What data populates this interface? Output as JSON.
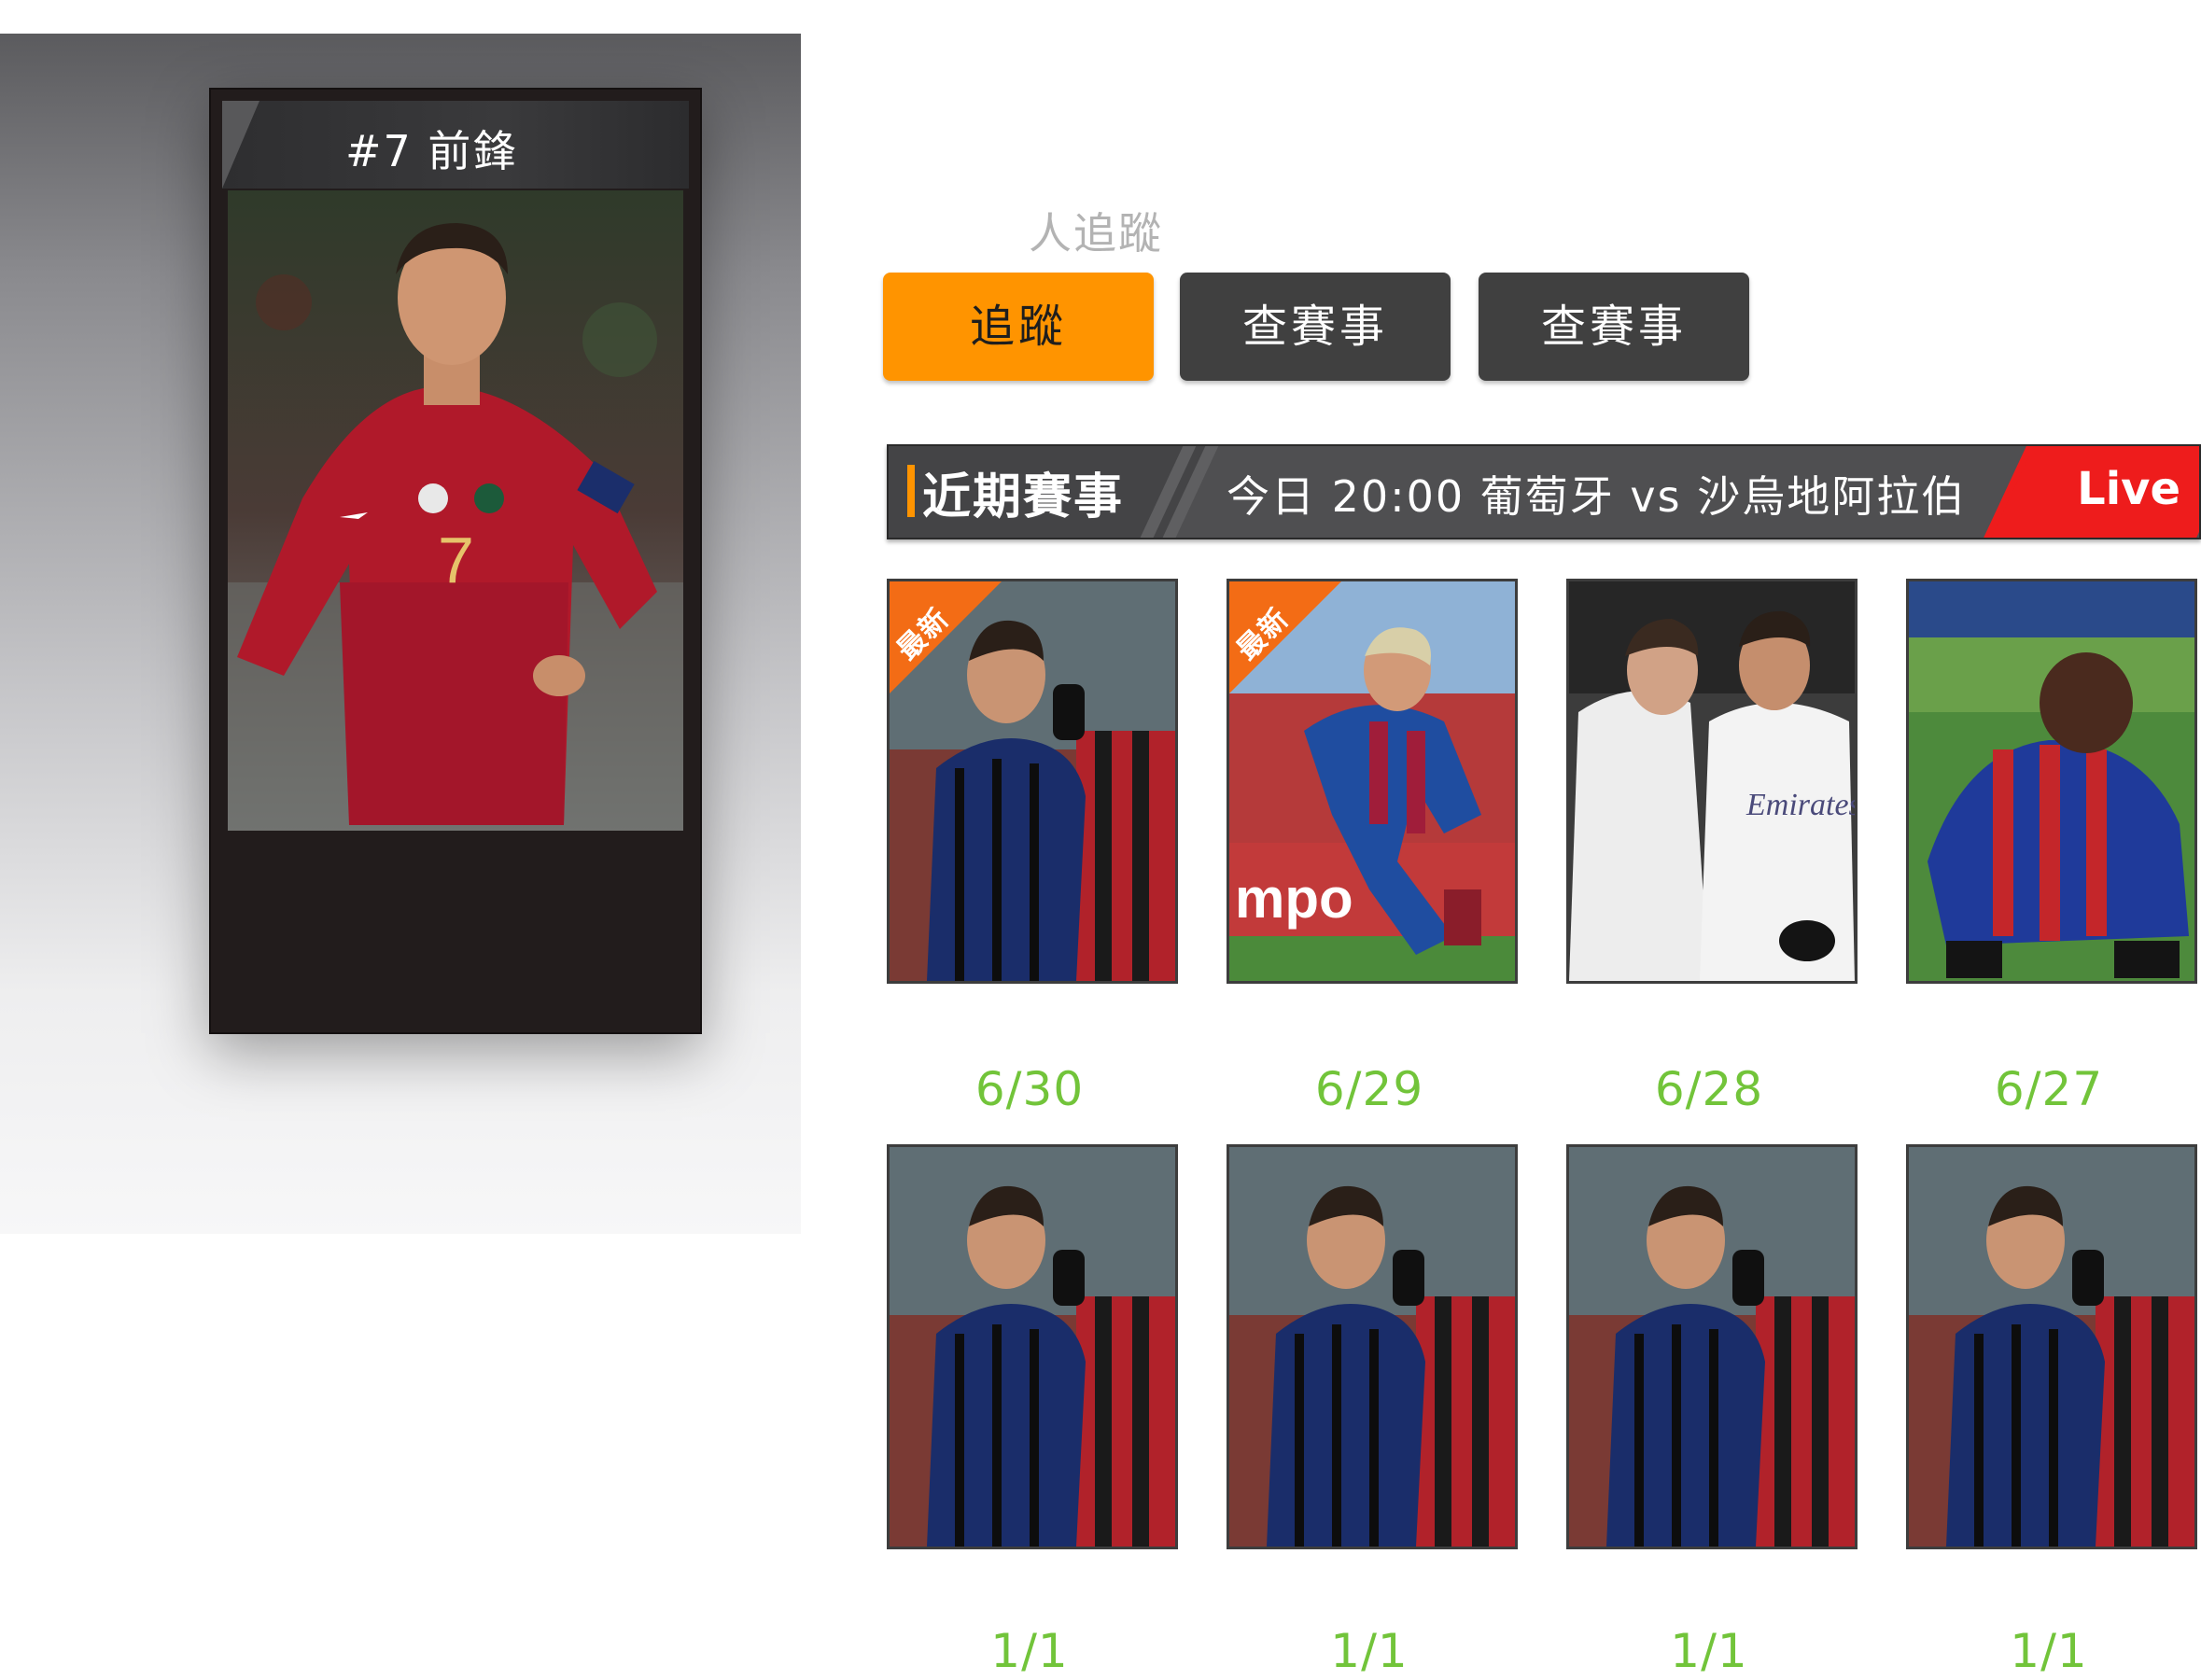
{
  "player": {
    "title": "#7 前鋒"
  },
  "follow": {
    "count_label": "人追蹤"
  },
  "buttons": {
    "follow": "追蹤",
    "schedule_1": "查賽事",
    "schedule_2": "查賽事"
  },
  "match_bar": {
    "label": "近期賽事",
    "info": "今日  20:00 葡萄牙 vs 沙烏地阿拉伯",
    "live": "Live"
  },
  "badge_label": "最新",
  "row1": [
    {
      "date": "6/30",
      "badge": true
    },
    {
      "date": "6/29",
      "badge": true
    },
    {
      "date": "6/28",
      "badge": false
    },
    {
      "date": "6/27",
      "badge": false
    }
  ],
  "row2": [
    {
      "date": "1/1"
    },
    {
      "date": "1/1"
    },
    {
      "date": "1/1"
    },
    {
      "date": "1/1"
    }
  ],
  "colors": {
    "accent": "#ff9400",
    "live": "#ee1c1c",
    "date": "#72c43a",
    "ribbon": "#f36c15"
  }
}
